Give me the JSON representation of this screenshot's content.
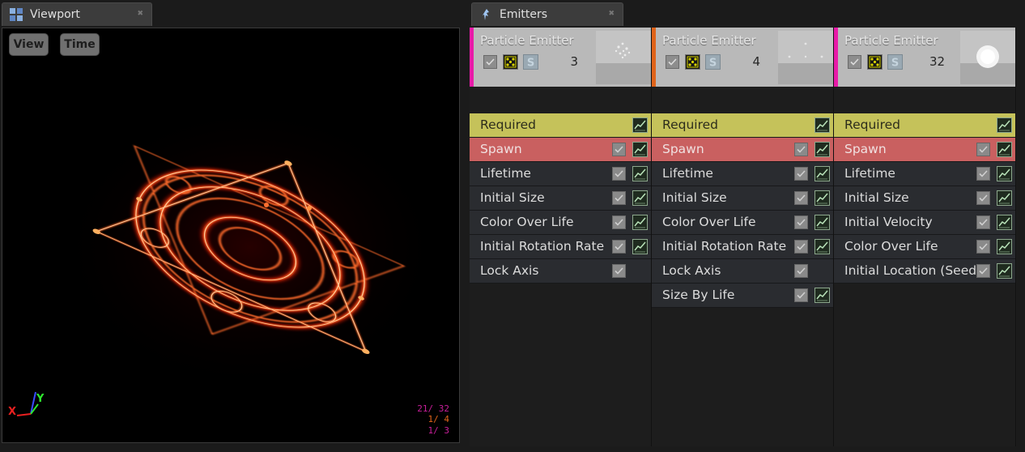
{
  "viewport_tab": {
    "title": "Viewport"
  },
  "emitters_tab": {
    "title": "Emitters"
  },
  "viewport": {
    "buttons": {
      "view": "View",
      "time": "Time"
    },
    "axes": {
      "x": "X",
      "y": "Y"
    },
    "stats": [
      {
        "text": "21/  32",
        "color": "#c81e9a"
      },
      {
        "text": "1/  4",
        "color": "#e0641a"
      },
      {
        "text": "1/  3",
        "color": "#c81e9a"
      }
    ]
  },
  "emitters": [
    {
      "name": "Particle Emitter",
      "count": "3",
      "color": "#e81aa8",
      "thumbnail": "sparkle-thumbnail",
      "modules": [
        {
          "label": "Required",
          "type": "required",
          "checkbox": false,
          "curve": true
        },
        {
          "label": "Spawn",
          "type": "spawn",
          "checkbox": true,
          "curve": true
        },
        {
          "label": "Lifetime",
          "type": "normal",
          "checkbox": true,
          "curve": true
        },
        {
          "label": "Initial Size",
          "type": "normal",
          "checkbox": true,
          "curve": true
        },
        {
          "label": "Color Over Life",
          "type": "normal",
          "checkbox": true,
          "curve": true
        },
        {
          "label": "Initial Rotation Rate",
          "type": "normal",
          "checkbox": true,
          "curve": true
        },
        {
          "label": "Lock Axis",
          "type": "normal",
          "checkbox": true,
          "curve": false
        }
      ]
    },
    {
      "name": "Particle Emitter",
      "count": "4",
      "color": "#e0641a",
      "thumbnail": "dots-thumbnail",
      "modules": [
        {
          "label": "Required",
          "type": "required",
          "checkbox": false,
          "curve": true
        },
        {
          "label": "Spawn",
          "type": "spawn",
          "checkbox": true,
          "curve": true
        },
        {
          "label": "Lifetime",
          "type": "normal",
          "checkbox": true,
          "curve": true
        },
        {
          "label": "Initial Size",
          "type": "normal",
          "checkbox": true,
          "curve": true
        },
        {
          "label": "Color Over Life",
          "type": "normal",
          "checkbox": true,
          "curve": true
        },
        {
          "label": "Initial Rotation Rate",
          "type": "normal",
          "checkbox": true,
          "curve": true
        },
        {
          "label": "Lock Axis",
          "type": "normal",
          "checkbox": true,
          "curve": false
        },
        {
          "label": "Size By Life",
          "type": "normal",
          "checkbox": true,
          "curve": true
        }
      ]
    },
    {
      "name": "Particle Emitter",
      "count": "32",
      "color": "#e81aa8",
      "thumbnail": "glow-thumbnail",
      "modules": [
        {
          "label": "Required",
          "type": "required",
          "checkbox": false,
          "curve": true
        },
        {
          "label": "Spawn",
          "type": "spawn",
          "checkbox": true,
          "curve": true
        },
        {
          "label": "Lifetime",
          "type": "normal",
          "checkbox": true,
          "curve": true
        },
        {
          "label": "Initial Size",
          "type": "normal",
          "checkbox": true,
          "curve": true
        },
        {
          "label": "Initial Velocity",
          "type": "normal",
          "checkbox": true,
          "curve": true
        },
        {
          "label": "Color Over Life",
          "type": "normal",
          "checkbox": true,
          "curve": true
        },
        {
          "label": "Initial Location (Seed)",
          "type": "normal",
          "checkbox": true,
          "curve": true
        }
      ]
    }
  ],
  "colors": {
    "required": "#c5c25a",
    "spawn": "#c96060",
    "module_bg": "#2a2c30",
    "effect_glow": "#ff2a10"
  }
}
